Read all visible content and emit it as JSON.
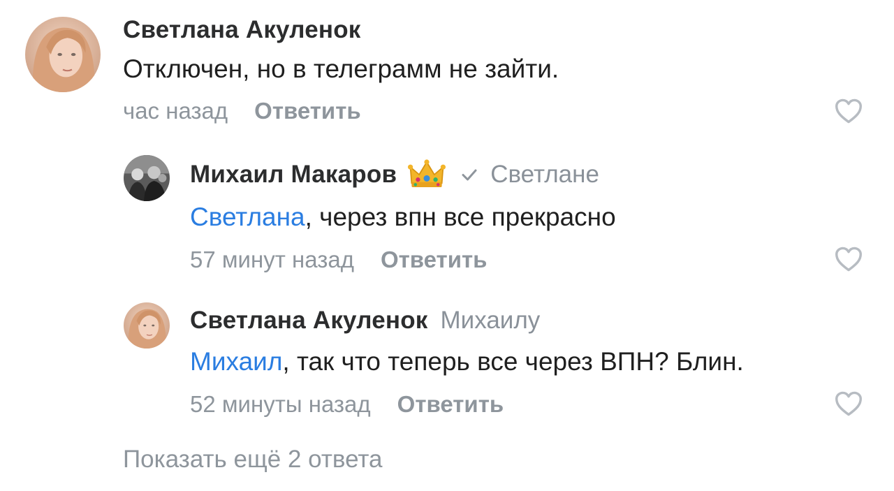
{
  "comments": [
    {
      "author": "Светлана Акуленок",
      "reply_to": "",
      "mention": "",
      "text": "Отключен, но в телеграмм не зайти.",
      "time": "час назад",
      "reply_label": "Ответить",
      "avatar_icon": "avatar-photo-woman",
      "like_icon": "heart-outline-icon"
    },
    {
      "author": "Михаил Макаров",
      "badge_icon": "crown-icon",
      "verified_icon": "checkmark-icon",
      "reply_to": "Светлане",
      "mention": "Светлана",
      "text": ", через впн все прекрасно",
      "time": "57 минут назад",
      "reply_label": "Ответить",
      "avatar_icon": "avatar-photo-group",
      "like_icon": "heart-outline-icon"
    },
    {
      "author": "Светлана Акуленок",
      "reply_to": "Михаилу",
      "mention": "Михаил",
      "text": ", так что теперь все через ВПН? Блин.",
      "time": "52 минуты назад",
      "reply_label": "Ответить",
      "avatar_icon": "avatar-photo-woman",
      "like_icon": "heart-outline-icon"
    }
  ],
  "show_more": "Показать ещё 2 ответа",
  "colors": {
    "mention": "#2a7de1",
    "secondary_text": "#8e959c",
    "primary_text": "#1f1f1f"
  }
}
